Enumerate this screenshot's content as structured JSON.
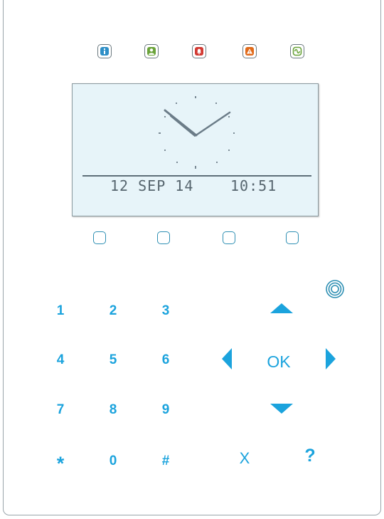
{
  "status_leds": [
    {
      "name": "info",
      "icon": "info-icon",
      "color": "#2e8fc7"
    },
    {
      "name": "user",
      "icon": "user-icon",
      "color": "#6aa33a"
    },
    {
      "name": "alarm",
      "icon": "bell-icon",
      "color": "#d23a33"
    },
    {
      "name": "warning",
      "icon": "warning-triangle-icon",
      "color": "#e06a1a"
    },
    {
      "name": "power",
      "icon": "ac-power-icon",
      "color": "#6aa33a"
    }
  ],
  "lcd": {
    "clock_icon": "analog-clock-icon",
    "date": "12 SEP 14",
    "time": "10:51"
  },
  "soft_keys": [
    "soft-key-1",
    "soft-key-2",
    "soft-key-3",
    "soft-key-4"
  ],
  "proximity_icon": "proximity-reader-icon",
  "keypad": {
    "digits": [
      "1",
      "2",
      "3",
      "4",
      "5",
      "6",
      "7",
      "8",
      "9",
      "*",
      "0",
      "#"
    ],
    "ok": "OK",
    "cancel": "X",
    "help": "?"
  },
  "colors": {
    "key_accent": "#1ba3dd",
    "soft_key_outline": "#2e8fb3",
    "lcd_background": "#e7f4f9",
    "lcd_text": "#56656e",
    "bezel": "#9aa4aa"
  }
}
